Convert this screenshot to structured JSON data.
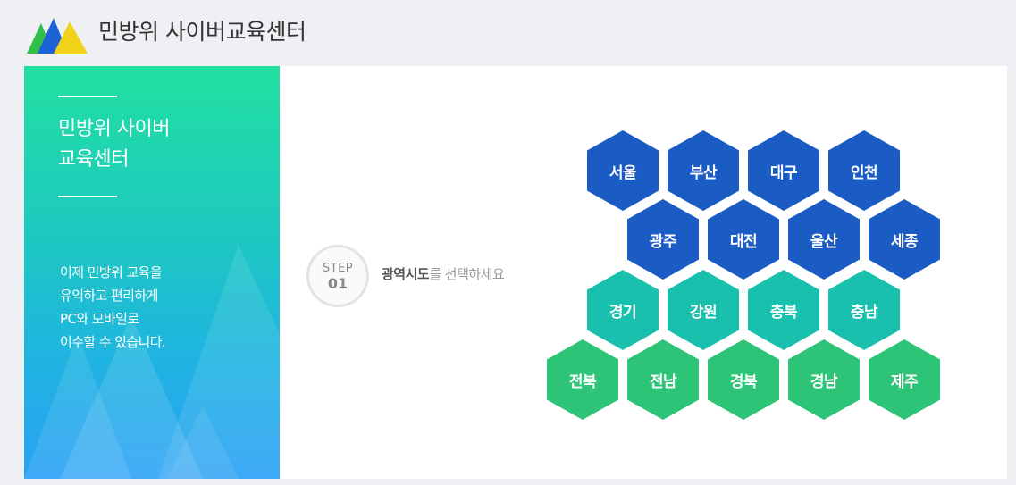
{
  "header": {
    "site_title": "민방위 사이버교육센터"
  },
  "side": {
    "title_line1": "민방위 사이버",
    "title_line2": "교육센터",
    "desc_lines": [
      "이제 민방위 교육을",
      "유익하고 편리하게",
      "PC와 모바일로",
      "이수할 수 있습니다."
    ]
  },
  "step": {
    "label": "STEP",
    "number": "01",
    "text_bold": "광역시도",
    "text_rest": "를 선택하세요"
  },
  "regions": {
    "row1": [
      "서울",
      "부산",
      "대구",
      "인천"
    ],
    "row2": [
      "광주",
      "대전",
      "울산",
      "세종"
    ],
    "row3": [
      "경기",
      "강원",
      "충북",
      "충남"
    ],
    "row4": [
      "전북",
      "전남",
      "경북",
      "경남",
      "제주"
    ]
  },
  "colors": {
    "row1": "#1a5bc4",
    "row2": "#1a5bc4",
    "row3": "#18c0ad",
    "row4": "#2ec477"
  }
}
